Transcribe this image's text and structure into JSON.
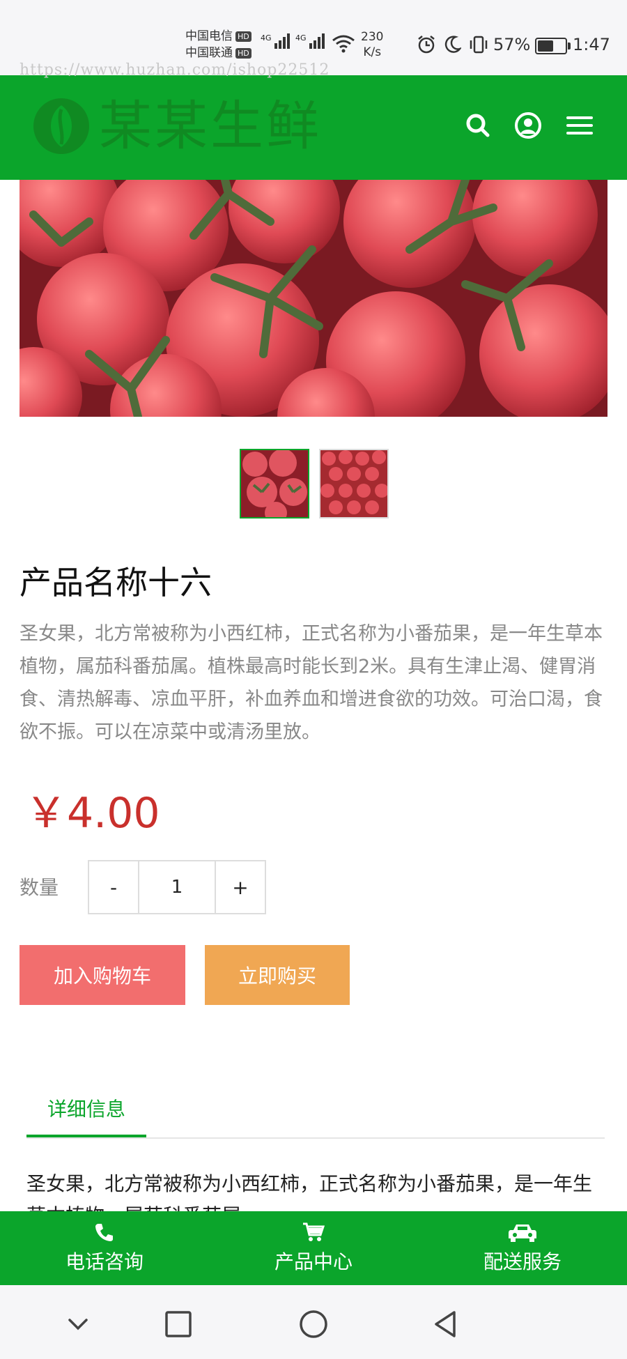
{
  "status_bar": {
    "carrier1": "中国电信",
    "carrier2": "中国联通",
    "hd_badge": "HD",
    "network1": "4G",
    "network2": "4G",
    "speed_value": "230",
    "speed_unit": "K/s",
    "battery_percent": "57%",
    "battery_level": 0.57,
    "time": "1:47",
    "icons": [
      "alarm-icon",
      "moon-icon",
      "vibrate-icon"
    ]
  },
  "watermark": "https://www.huzhan.com/ishop22512",
  "header": {
    "brand": "某某生鲜",
    "icons": [
      "search-icon",
      "user-icon",
      "menu-icon"
    ]
  },
  "product": {
    "title": "产品名称十六",
    "description": "圣女果，北方常被称为小西红柿，正式名称为小番茄果，是一年生草本植物，属茄科番茄属。植株最高时能长到2米。具有生津止渴、健胃消食、清热解毒、凉血平肝，补血养血和增进食欲的功效。可治口渴，食欲不振。可以在凉菜中或清汤里放。",
    "price": "￥4.00",
    "quantity_label": "数量",
    "quantity": "1",
    "decrease": "-",
    "increase": "+",
    "add_to_cart": "加入购物车",
    "buy_now": "立即购买"
  },
  "tabs": {
    "detail_tab": "详细信息",
    "detail_text": "圣女果，北方常被称为小西红柿，正式名称为小番茄果，是一年生草本植物，属茄科番茄属。"
  },
  "footer": {
    "items": [
      {
        "label": "电话咨询",
        "icon": "phone-icon"
      },
      {
        "label": "产品中心",
        "icon": "cart-icon"
      },
      {
        "label": "配送服务",
        "icon": "car-icon"
      }
    ]
  },
  "colors": {
    "brand_green": "#0ba52b",
    "price_red": "#c9302c",
    "cart_button": "#f26e6e",
    "buy_button": "#f0a753"
  }
}
